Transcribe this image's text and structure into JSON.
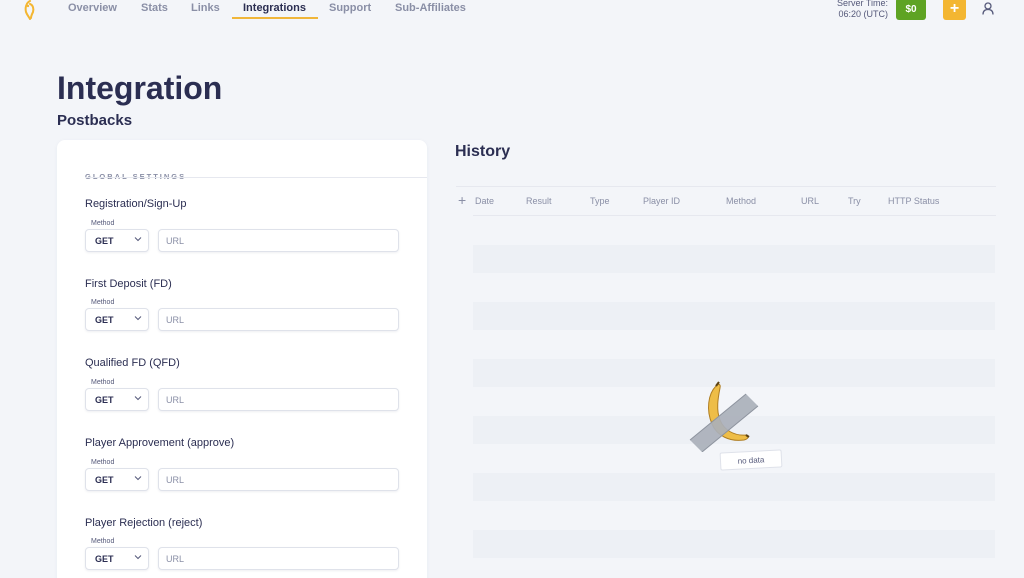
{
  "nav": {
    "tabs": [
      {
        "label": "Overview"
      },
      {
        "label": "Stats"
      },
      {
        "label": "Links"
      },
      {
        "label": "Integrations",
        "active": true
      },
      {
        "label": "Support"
      },
      {
        "label": "Sub-Affiliates"
      }
    ],
    "server_time_label": "Server Time:",
    "server_time_value": "06:20 (UTC)",
    "balance": "$0",
    "plus_label": "+"
  },
  "page": {
    "title": "Integration",
    "subtitle": "Postbacks"
  },
  "global_settings": {
    "title": "GLOBAL SETTINGS",
    "method_label": "Method",
    "url_placeholder": "URL",
    "postbacks": [
      {
        "label": "Registration/Sign-Up",
        "method": "GET"
      },
      {
        "label": "First Deposit (FD)",
        "method": "GET"
      },
      {
        "label": "Qualified FD (QFD)",
        "method": "GET"
      },
      {
        "label": "Player Approvement (approve)",
        "method": "GET"
      },
      {
        "label": "Player Rejection (reject)",
        "method": "GET"
      }
    ]
  },
  "history": {
    "title": "History",
    "columns": [
      "Date",
      "Result",
      "Type",
      "Player ID",
      "Method",
      "URL",
      "Try",
      "HTTP Status"
    ],
    "empty_text": "no data"
  },
  "colors": {
    "accent_yellow": "#f3b632",
    "balance_green": "#5ea323",
    "text_dark": "#2b2e52",
    "text_muted": "#8a8fa6"
  },
  "icons": [
    "logo-icon",
    "user-icon",
    "chevron-down-icon",
    "plus-icon",
    "banana-illustration"
  ]
}
